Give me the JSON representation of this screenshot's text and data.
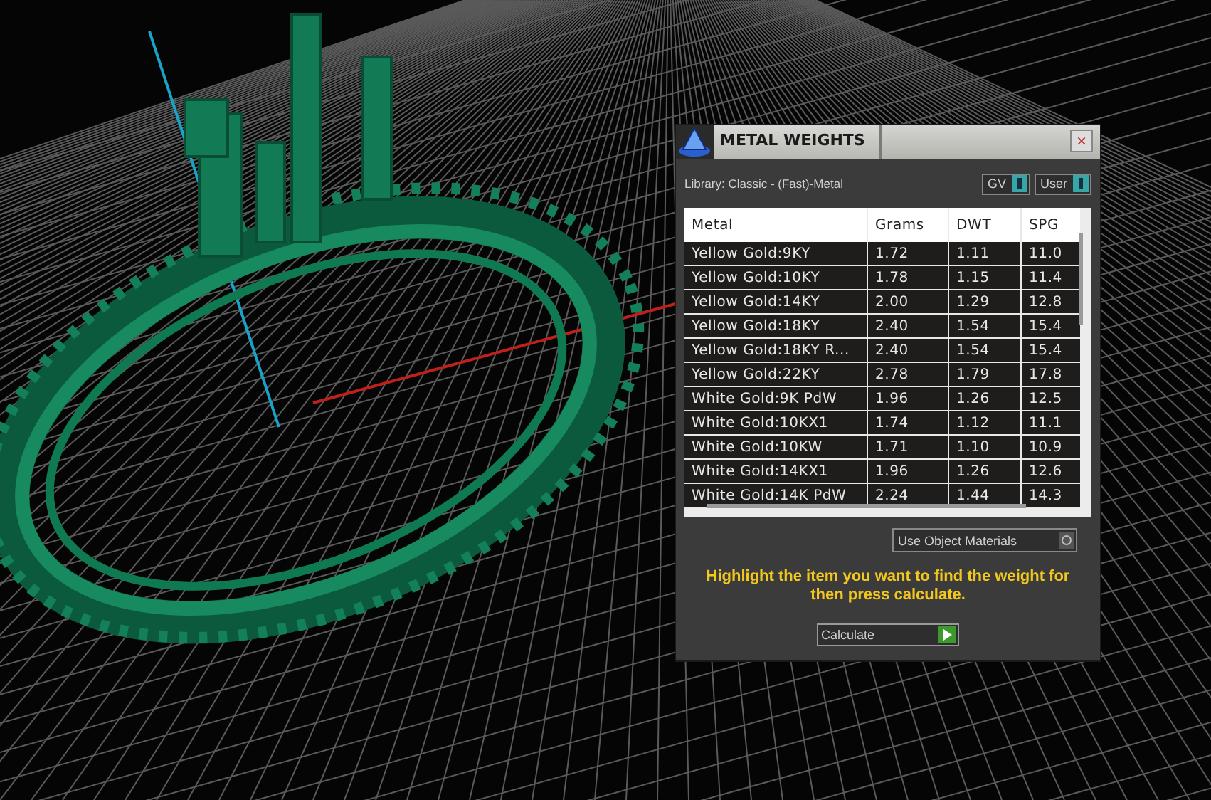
{
  "window": {
    "title": "METAL WEIGHTS",
    "close": "×"
  },
  "library": "Library: Classic - (Fast)-Metal",
  "toggles": [
    {
      "label": "GV",
      "on": true
    },
    {
      "label": "User",
      "on": true
    }
  ],
  "table": {
    "columns": [
      "Metal",
      "Grams",
      "DWT",
      "SPG"
    ],
    "rows": [
      {
        "cells": [
          "Yellow Gold:9KY",
          "1.72",
          "1.11",
          "11.0"
        ]
      },
      {
        "cells": [
          "Yellow Gold:10KY",
          "1.78",
          "1.15",
          "11.4"
        ]
      },
      {
        "cells": [
          "Yellow Gold:14KY",
          "2.00",
          "1.29",
          "12.8"
        ]
      },
      {
        "cells": [
          "Yellow Gold:18KY",
          "2.40",
          "1.54",
          "15.4"
        ]
      },
      {
        "cells": [
          "Yellow Gold:18KY R...",
          "2.40",
          "1.54",
          "15.4"
        ]
      },
      {
        "cells": [
          "Yellow Gold:22KY",
          "2.78",
          "1.79",
          "17.8"
        ]
      },
      {
        "cells": [
          "White Gold:9K PdW",
          "1.96",
          "1.26",
          "12.5"
        ]
      },
      {
        "cells": [
          "White Gold:10KX1",
          "1.74",
          "1.12",
          "11.1"
        ]
      },
      {
        "cells": [
          "White Gold:10KW",
          "1.71",
          "1.10",
          "10.9"
        ]
      },
      {
        "cells": [
          "White Gold:14KX1",
          "1.96",
          "1.26",
          "12.6"
        ]
      },
      {
        "cells": [
          "White Gold:14K PdW",
          "2.24",
          "1.44",
          "14.3"
        ]
      }
    ]
  },
  "use_object_materials": {
    "label": "Use Object Materials",
    "on": false
  },
  "hint": "Highlight the item you want to find the weight for then press calculate.",
  "calculate_button": "Calculate"
}
